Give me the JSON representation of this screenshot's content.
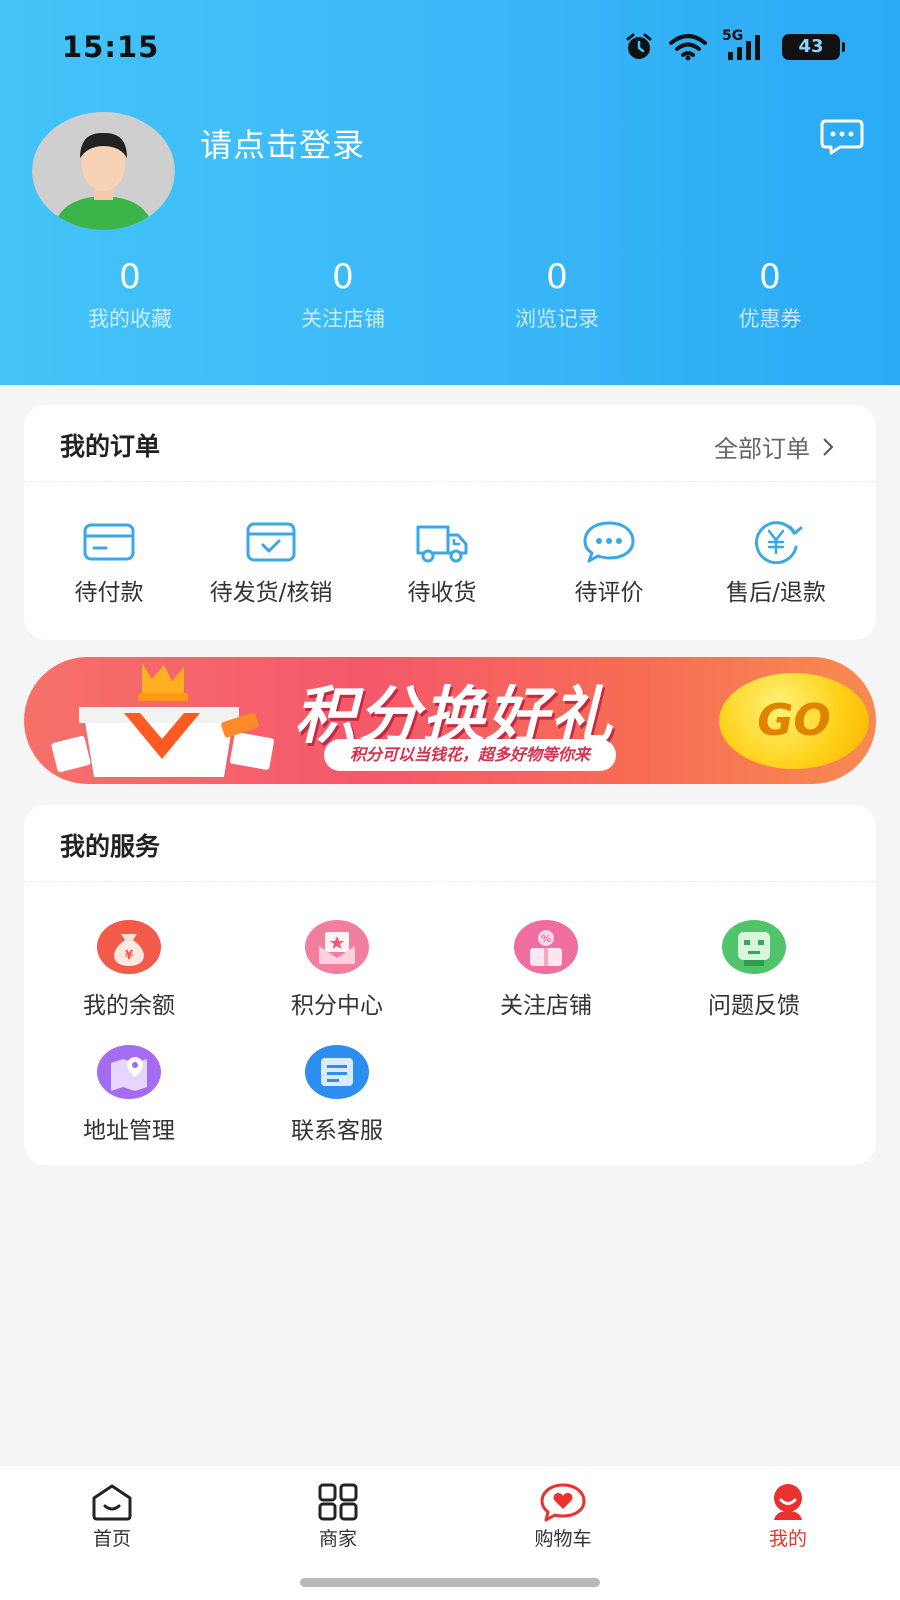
{
  "status_bar": {
    "time": "15:15",
    "network": "5G",
    "battery": "43"
  },
  "profile": {
    "login_prompt": "请点击登录"
  },
  "stats": [
    {
      "value": "0",
      "label": "我的收藏"
    },
    {
      "value": "0",
      "label": "关注店铺"
    },
    {
      "value": "0",
      "label": "浏览记录"
    },
    {
      "value": "0",
      "label": "优惠券"
    }
  ],
  "orders": {
    "title": "我的订单",
    "all_label": "全部订单",
    "items": [
      {
        "label": "待付款",
        "icon": "card-icon"
      },
      {
        "label": "待发货/核销",
        "icon": "box-check-icon"
      },
      {
        "label": "待收货",
        "icon": "truck-icon"
      },
      {
        "label": "待评价",
        "icon": "chat-dots-icon"
      },
      {
        "label": "售后/退款",
        "icon": "yen-refund-icon"
      }
    ]
  },
  "banner": {
    "title": "积分换好礼",
    "subtitle": "积分可以当钱花，超多好物等你来",
    "go_label": "GO"
  },
  "services": {
    "title": "我的服务",
    "items": [
      {
        "label": "我的余额",
        "icon": "money-bag-icon",
        "color": "#f25a4a"
      },
      {
        "label": "积分中心",
        "icon": "envelope-star-icon",
        "color": "#f27fa0"
      },
      {
        "label": "关注店铺",
        "icon": "gift-shop-icon",
        "color": "#f06d9f"
      },
      {
        "label": "问题反馈",
        "icon": "feedback-face-icon",
        "color": "#4fc46a"
      },
      {
        "label": "地址管理",
        "icon": "map-pin-icon",
        "color": "#a46cf0"
      },
      {
        "label": "联系客服",
        "icon": "service-message-icon",
        "color": "#2e8ef0"
      }
    ]
  },
  "tabbar": {
    "items": [
      {
        "label": "首页",
        "icon": "home-icon"
      },
      {
        "label": "商家",
        "icon": "grid-icon"
      },
      {
        "label": "购物车",
        "icon": "cart-heart-icon"
      },
      {
        "label": "我的",
        "icon": "profile-icon",
        "active": true
      }
    ]
  },
  "colors": {
    "accent": "#e9312d",
    "header": "#3ab7f7",
    "icon_blue": "#3aa8e8"
  }
}
